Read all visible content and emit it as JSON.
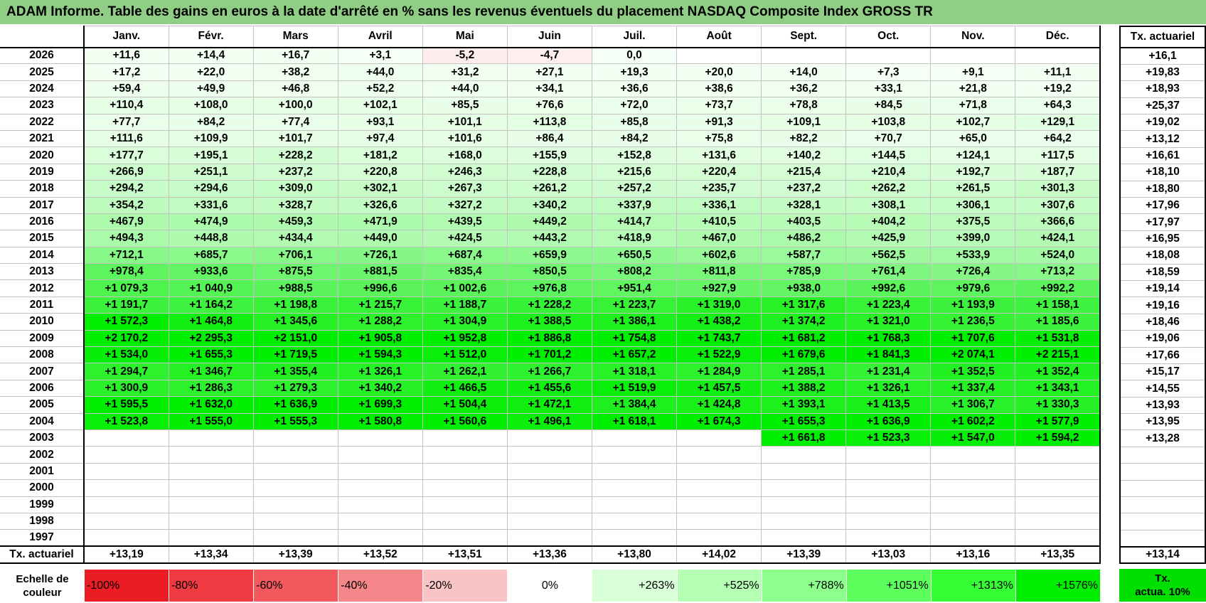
{
  "title": "ADAM Informe. Table des gains en euros à la date d'arrêté en % sans les revenus éventuels du placement NASDAQ Composite Index GROSS TR",
  "months": [
    "Janv.",
    "Févr.",
    "Mars",
    "Avril",
    "Mai",
    "Juin",
    "Juil.",
    "Août",
    "Sept.",
    "Oct.",
    "Nov.",
    "Déc."
  ],
  "tx_header": "Tx. actuariel",
  "rows": [
    {
      "year": "2026",
      "cells": [
        "+11,6",
        "+14,4",
        "+16,7",
        "+3,1",
        "-5,2",
        "-4,7",
        "0,0",
        "",
        "",
        "",
        "",
        ""
      ],
      "tx": "+16,1"
    },
    {
      "year": "2025",
      "cells": [
        "+17,2",
        "+22,0",
        "+38,2",
        "+44,0",
        "+31,2",
        "+27,1",
        "+19,3",
        "+20,0",
        "+14,0",
        "+7,3",
        "+9,1",
        "+11,1"
      ],
      "tx": "+19,83"
    },
    {
      "year": "2024",
      "cells": [
        "+59,4",
        "+49,9",
        "+46,8",
        "+52,2",
        "+44,0",
        "+34,1",
        "+36,6",
        "+38,6",
        "+36,2",
        "+33,1",
        "+21,8",
        "+19,2"
      ],
      "tx": "+18,93"
    },
    {
      "year": "2023",
      "cells": [
        "+110,4",
        "+108,0",
        "+100,0",
        "+102,1",
        "+85,5",
        "+76,6",
        "+72,0",
        "+73,7",
        "+78,8",
        "+84,5",
        "+71,8",
        "+64,3"
      ],
      "tx": "+25,37"
    },
    {
      "year": "2022",
      "cells": [
        "+77,7",
        "+84,2",
        "+77,4",
        "+93,1",
        "+101,1",
        "+113,8",
        "+85,8",
        "+91,3",
        "+109,1",
        "+103,8",
        "+102,7",
        "+129,1"
      ],
      "tx": "+19,02"
    },
    {
      "year": "2021",
      "cells": [
        "+111,6",
        "+109,9",
        "+101,7",
        "+97,4",
        "+101,6",
        "+86,4",
        "+84,2",
        "+75,8",
        "+82,2",
        "+70,7",
        "+65,0",
        "+64,2"
      ],
      "tx": "+13,12"
    },
    {
      "year": "2020",
      "cells": [
        "+177,7",
        "+195,1",
        "+228,2",
        "+181,2",
        "+168,0",
        "+155,9",
        "+152,8",
        "+131,6",
        "+140,2",
        "+144,5",
        "+124,1",
        "+117,5"
      ],
      "tx": "+16,61"
    },
    {
      "year": "2019",
      "cells": [
        "+266,9",
        "+251,1",
        "+237,2",
        "+220,8",
        "+246,3",
        "+228,8",
        "+215,6",
        "+220,4",
        "+215,4",
        "+210,4",
        "+192,7",
        "+187,7"
      ],
      "tx": "+18,10"
    },
    {
      "year": "2018",
      "cells": [
        "+294,2",
        "+294,6",
        "+309,0",
        "+302,1",
        "+267,3",
        "+261,2",
        "+257,2",
        "+235,7",
        "+237,2",
        "+262,2",
        "+261,5",
        "+301,3"
      ],
      "tx": "+18,80"
    },
    {
      "year": "2017",
      "cells": [
        "+354,2",
        "+331,6",
        "+328,7",
        "+326,6",
        "+327,2",
        "+340,2",
        "+337,9",
        "+336,1",
        "+328,1",
        "+308,1",
        "+306,1",
        "+307,6"
      ],
      "tx": "+17,96"
    },
    {
      "year": "2016",
      "cells": [
        "+467,9",
        "+474,9",
        "+459,3",
        "+471,9",
        "+439,5",
        "+449,2",
        "+414,7",
        "+410,5",
        "+403,5",
        "+404,2",
        "+375,5",
        "+366,6"
      ],
      "tx": "+17,97"
    },
    {
      "year": "2015",
      "cells": [
        "+494,3",
        "+448,8",
        "+434,4",
        "+449,0",
        "+424,5",
        "+443,2",
        "+418,9",
        "+467,0",
        "+486,2",
        "+425,9",
        "+399,0",
        "+424,1"
      ],
      "tx": "+16,95"
    },
    {
      "year": "2014",
      "cells": [
        "+712,1",
        "+685,7",
        "+706,1",
        "+726,1",
        "+687,4",
        "+659,9",
        "+650,5",
        "+602,6",
        "+587,7",
        "+562,5",
        "+533,9",
        "+524,0"
      ],
      "tx": "+18,08"
    },
    {
      "year": "2013",
      "cells": [
        "+978,4",
        "+933,6",
        "+875,5",
        "+881,5",
        "+835,4",
        "+850,5",
        "+808,2",
        "+811,8",
        "+785,9",
        "+761,4",
        "+726,4",
        "+713,2"
      ],
      "tx": "+18,59"
    },
    {
      "year": "2012",
      "cells": [
        "+1 079,3",
        "+1 040,9",
        "+988,5",
        "+996,6",
        "+1 002,6",
        "+976,8",
        "+951,4",
        "+927,9",
        "+938,0",
        "+992,6",
        "+979,6",
        "+992,2"
      ],
      "tx": "+19,14"
    },
    {
      "year": "2011",
      "cells": [
        "+1 191,7",
        "+1 164,2",
        "+1 198,8",
        "+1 215,7",
        "+1 188,7",
        "+1 228,2",
        "+1 223,7",
        "+1 319,0",
        "+1 317,6",
        "+1 223,4",
        "+1 193,9",
        "+1 158,1"
      ],
      "tx": "+19,16"
    },
    {
      "year": "2010",
      "cells": [
        "+1 572,3",
        "+1 464,8",
        "+1 345,6",
        "+1 288,2",
        "+1 304,9",
        "+1 388,5",
        "+1 386,1",
        "+1 438,2",
        "+1 374,2",
        "+1 321,0",
        "+1 236,5",
        "+1 185,6"
      ],
      "tx": "+18,46"
    },
    {
      "year": "2009",
      "cells": [
        "+2 170,2",
        "+2 295,3",
        "+2 151,0",
        "+1 905,8",
        "+1 952,8",
        "+1 886,8",
        "+1 754,8",
        "+1 743,7",
        "+1 681,2",
        "+1 768,3",
        "+1 707,6",
        "+1 531,8"
      ],
      "tx": "+19,06"
    },
    {
      "year": "2008",
      "cells": [
        "+1 534,0",
        "+1 655,3",
        "+1 719,5",
        "+1 594,3",
        "+1 512,0",
        "+1 701,2",
        "+1 657,2",
        "+1 522,9",
        "+1 679,6",
        "+1 841,3",
        "+2 074,1",
        "+2 215,1"
      ],
      "tx": "+17,66"
    },
    {
      "year": "2007",
      "cells": [
        "+1 294,7",
        "+1 346,7",
        "+1 355,4",
        "+1 326,1",
        "+1 262,1",
        "+1 266,7",
        "+1 318,1",
        "+1 284,9",
        "+1 285,1",
        "+1 231,4",
        "+1 352,5",
        "+1 352,4"
      ],
      "tx": "+15,17"
    },
    {
      "year": "2006",
      "cells": [
        "+1 300,9",
        "+1 286,3",
        "+1 279,3",
        "+1 340,2",
        "+1 466,5",
        "+1 455,6",
        "+1 519,9",
        "+1 457,5",
        "+1 388,2",
        "+1 326,1",
        "+1 337,4",
        "+1 343,1"
      ],
      "tx": "+14,55"
    },
    {
      "year": "2005",
      "cells": [
        "+1 595,5",
        "+1 632,0",
        "+1 636,9",
        "+1 699,3",
        "+1 504,4",
        "+1 472,1",
        "+1 384,4",
        "+1 424,8",
        "+1 393,1",
        "+1 413,5",
        "+1 306,7",
        "+1 330,3"
      ],
      "tx": "+13,93"
    },
    {
      "year": "2004",
      "cells": [
        "+1 523,8",
        "+1 555,0",
        "+1 555,3",
        "+1 580,8",
        "+1 560,6",
        "+1 496,1",
        "+1 618,1",
        "+1 674,3",
        "+1 655,3",
        "+1 636,9",
        "+1 602,2",
        "+1 577,9"
      ],
      "tx": "+13,95"
    },
    {
      "year": "2003",
      "cells": [
        "",
        "",
        "",
        "",
        "",
        "",
        "",
        "",
        "+1 661,8",
        "+1 523,3",
        "+1 547,0",
        "+1 594,2"
      ],
      "tx": "+13,28"
    },
    {
      "year": "2002",
      "cells": [
        "",
        "",
        "",
        "",
        "",
        "",
        "",
        "",
        "",
        "",
        "",
        ""
      ],
      "tx": ""
    },
    {
      "year": "2001",
      "cells": [
        "",
        "",
        "",
        "",
        "",
        "",
        "",
        "",
        "",
        "",
        "",
        ""
      ],
      "tx": ""
    },
    {
      "year": "2000",
      "cells": [
        "",
        "",
        "",
        "",
        "",
        "",
        "",
        "",
        "",
        "",
        "",
        ""
      ],
      "tx": ""
    },
    {
      "year": "1999",
      "cells": [
        "",
        "",
        "",
        "",
        "",
        "",
        "",
        "",
        "",
        "",
        "",
        ""
      ],
      "tx": ""
    },
    {
      "year": "1998",
      "cells": [
        "",
        "",
        "",
        "",
        "",
        "",
        "",
        "",
        "",
        "",
        "",
        ""
      ],
      "tx": ""
    },
    {
      "year": "1997",
      "cells": [
        "",
        "",
        "",
        "",
        "",
        "",
        "",
        "",
        "",
        "",
        "",
        ""
      ],
      "tx": ""
    }
  ],
  "avg_row": {
    "label": "Tx. actuariel",
    "cells": [
      "+13,19",
      "+13,34",
      "+13,39",
      "+13,52",
      "+13,51",
      "+13,36",
      "+13,80",
      "+14,02",
      "+13,39",
      "+13,03",
      "+13,16",
      "+13,35"
    ],
    "tx": "+13,14"
  },
  "color_scale": {
    "label_line1": "Echelle de",
    "label_line2": "couleur",
    "steps": [
      {
        "label": "-100%",
        "color": "#ec1c24",
        "align": "left"
      },
      {
        "label": "-80%",
        "color": "#ef3a41",
        "align": "left"
      },
      {
        "label": "-60%",
        "color": "#f2585e",
        "align": "left"
      },
      {
        "label": "-40%",
        "color": "#f5878b",
        "align": "left"
      },
      {
        "label": "-20%",
        "color": "#fac3c5",
        "align": "left"
      },
      {
        "label": "0%",
        "color": "#ffffff",
        "align": "center"
      },
      {
        "label": "+263%",
        "color": "#d9ffd9",
        "align": "right"
      },
      {
        "label": "+525%",
        "color": "#b4ffb4",
        "align": "right"
      },
      {
        "label": "+788%",
        "color": "#8cff8c",
        "align": "right"
      },
      {
        "label": "+1051%",
        "color": "#5cff5c",
        "align": "right"
      },
      {
        "label": "+1313%",
        "color": "#33ff33",
        "align": "right"
      },
      {
        "label": "+1576%",
        "color": "#00ee00",
        "align": "right"
      }
    ],
    "tx_legend_line1": "Tx.",
    "tx_legend_line2": "actua. 10%",
    "tx_legend_color": "#00e000"
  }
}
